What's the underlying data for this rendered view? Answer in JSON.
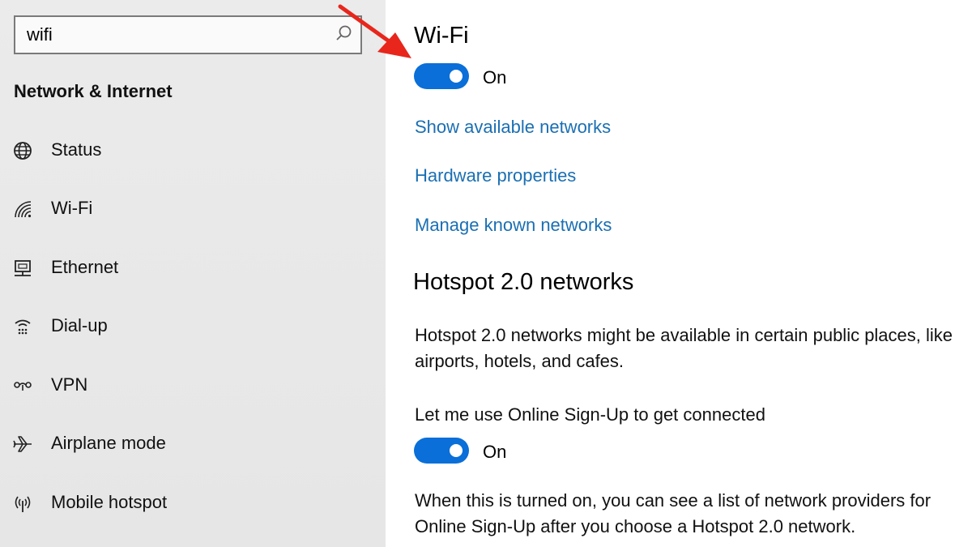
{
  "search": {
    "value": "wifi",
    "icon": "search-icon"
  },
  "sidebar": {
    "title": "Network & Internet",
    "items": [
      {
        "label": "Status",
        "icon": "globe-icon"
      },
      {
        "label": "Wi-Fi",
        "icon": "wifi-icon"
      },
      {
        "label": "Ethernet",
        "icon": "ethernet-icon"
      },
      {
        "label": "Dial-up",
        "icon": "dialup-icon"
      },
      {
        "label": "VPN",
        "icon": "vpn-icon"
      },
      {
        "label": "Airplane mode",
        "icon": "airplane-icon"
      },
      {
        "label": "Mobile hotspot",
        "icon": "hotspot-icon"
      }
    ]
  },
  "main": {
    "title": "Wi-Fi",
    "wifi_toggle": {
      "state": "On"
    },
    "links": [
      "Show available networks",
      "Hardware properties",
      "Manage known networks"
    ],
    "hotspot_title": "Hotspot 2.0 networks",
    "hotspot_desc": "Hotspot 2.0 networks might be available in certain public places, like airports, hotels, and cafes.",
    "signup_label": "Let me use Online Sign-Up to get connected",
    "signup_toggle": {
      "state": "On"
    },
    "signup_desc": "When this is turned on, you can see a list of network providers for Online Sign-Up after you choose a Hotspot 2.0 network."
  },
  "colors": {
    "accent": "#0a6fd8",
    "link": "#1a6fb3",
    "annotation_arrow": "#e8261c",
    "sidebar_bg": "#e8e8e8"
  }
}
